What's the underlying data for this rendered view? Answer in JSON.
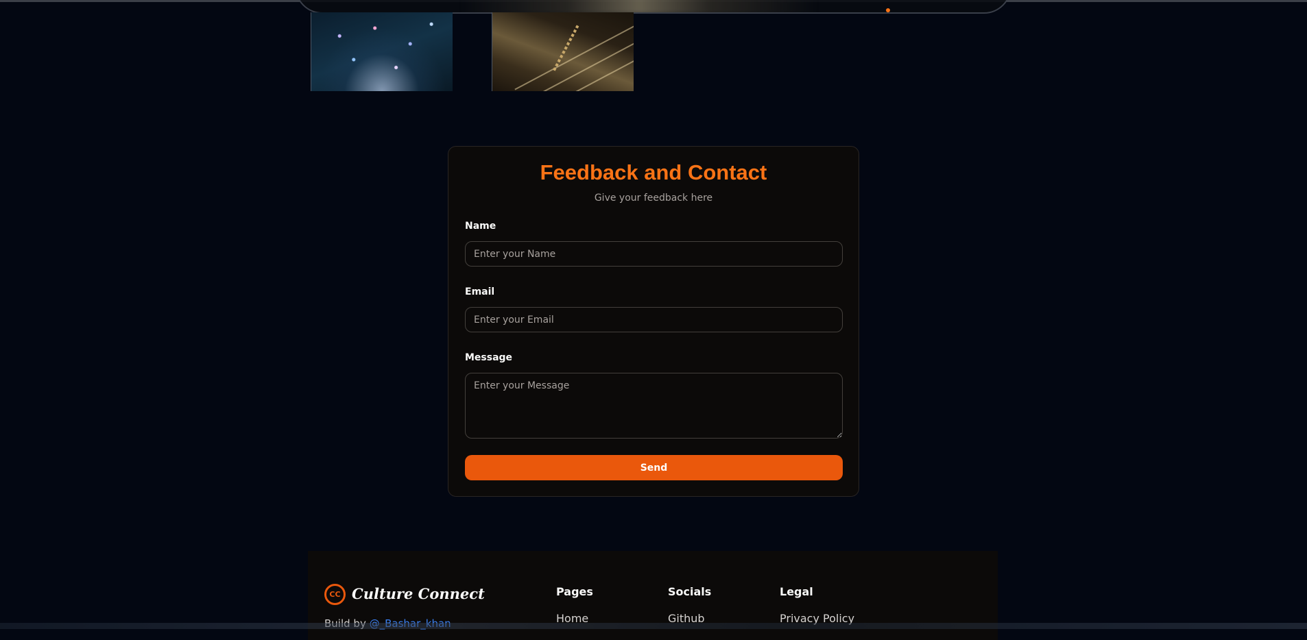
{
  "feedback": {
    "title": "Feedback and Contact",
    "subtitle": "Give your feedback here",
    "name_label": "Name",
    "name_placeholder": "Enter your Name",
    "email_label": "Email",
    "email_placeholder": "Enter your Email",
    "message_label": "Message",
    "message_placeholder": "Enter your Message",
    "send_label": "Send"
  },
  "footer": {
    "logo_mark": "CC",
    "brand": "Culture Connect",
    "build_by_prefix": "Build by",
    "build_by_author": "@_Bashar_khan",
    "columns": [
      {
        "heading": "Pages",
        "first_link": "Home"
      },
      {
        "heading": "Socials",
        "first_link": "Github"
      },
      {
        "heading": "Legal",
        "first_link": "Privacy Policy"
      }
    ]
  },
  "colors": {
    "accent": "#f97316",
    "button": "#ea580c",
    "background": "#030712",
    "card": "#0c0a09",
    "link": "#3b82f6"
  },
  "icons": {
    "logo": "cc-circle-icon"
  }
}
